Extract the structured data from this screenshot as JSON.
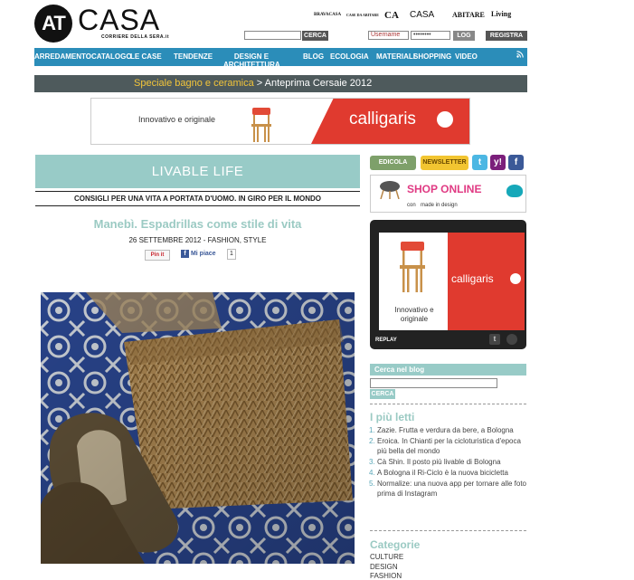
{
  "header": {
    "logo_at": "AT",
    "logo_casa": "CASA",
    "logo_sub": "CORRIERE DELLA SERA.it",
    "brands": [
      "BRAVACASA",
      "CASE DA ABITARE",
      "CA",
      "CASA",
      "ABITARE",
      "Living"
    ],
    "search_button": "CERCA",
    "username_placeholder": "Username",
    "password_placeholder": "••••••••",
    "login_button": "LOG",
    "register_button": "REGISTRA"
  },
  "nav": {
    "items": [
      "ARREDAMENTO",
      "CATALOGO",
      "LE CASE",
      "TENDENZE",
      "DESIGN E ARCHITETTURA",
      "BLOG",
      "ECOLOGIA",
      "MATERIALI",
      "SHOPPING",
      "VIDEO"
    ]
  },
  "promo": {
    "highlight": "Speciale bagno e ceramica",
    "separator": ">",
    "rest": "Anteprima Cersaie 2012"
  },
  "banner": {
    "tagline": "Innovativo e originale",
    "brand": "calligaris"
  },
  "blog": {
    "name": "LIVABLE LIFE",
    "tagline": "CONSIGLI PER UNA VITA A PORTATA D'UOMO. IN GIRO PER IL MONDO"
  },
  "post": {
    "title": "Manebì. Espadrillas come stile di vita",
    "meta": "26 SETTEMBRE 2012 - FASHION, STYLE",
    "pin_label": "Pin it",
    "like_label": "Mi piace",
    "like_count": "1"
  },
  "sidebar": {
    "edicola": "EDICOLA",
    "newsletter": "NEWSLETTER",
    "shop_title": "SHOP ONLINE",
    "shop_sub": "con",
    "shop_brand": "made in design",
    "video_tagline": "Innovativo e originale",
    "video_brand": "calligaris",
    "video_replay": "REPLAY",
    "search_head": "Cerca nel blog",
    "search_button": "CERCA",
    "popular_title": "I più letti",
    "popular": [
      "Zazie. Frutta e verdura da bere, a Bologna",
      "Eroica. In Chianti per la cicloturistica d'epoca più bella del mondo",
      "Cà Shin. Il posto più livable di Bologna",
      "A Bologna il Ri-Ciclo è la nuova bicicletta",
      "Normalize: una nuova app per tornare alle foto prima di Instagram"
    ],
    "categories_title": "Categorie",
    "categories": [
      "CULTURE",
      "DESIGN",
      "FASHION"
    ]
  },
  "colors": {
    "nav_blue": "#2b8db9",
    "mint": "#98cbc7",
    "calligaris_red": "#e03a2f"
  }
}
